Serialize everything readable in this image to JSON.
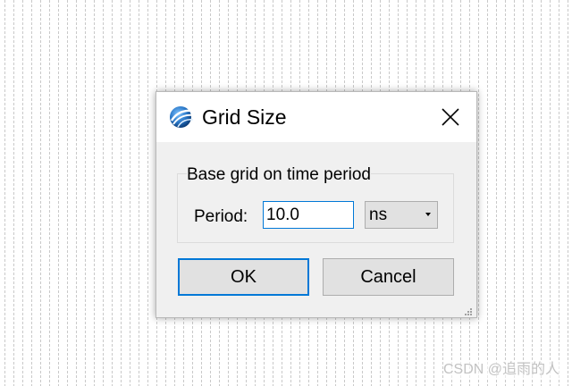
{
  "dialog": {
    "title": "Grid Size",
    "icon": "globe-app-icon",
    "close_icon": "close-icon"
  },
  "group": {
    "legend": "Base grid on time period",
    "period_label": "Period:",
    "period_value": "10.0",
    "unit_selected": "ns"
  },
  "buttons": {
    "ok_label": "OK",
    "cancel_label": "Cancel"
  },
  "watermark": "CSDN @追雨的人",
  "colors": {
    "accent": "#0078d7",
    "dialog_bg": "#f0f0f0",
    "button_bg": "#e1e1e1"
  }
}
